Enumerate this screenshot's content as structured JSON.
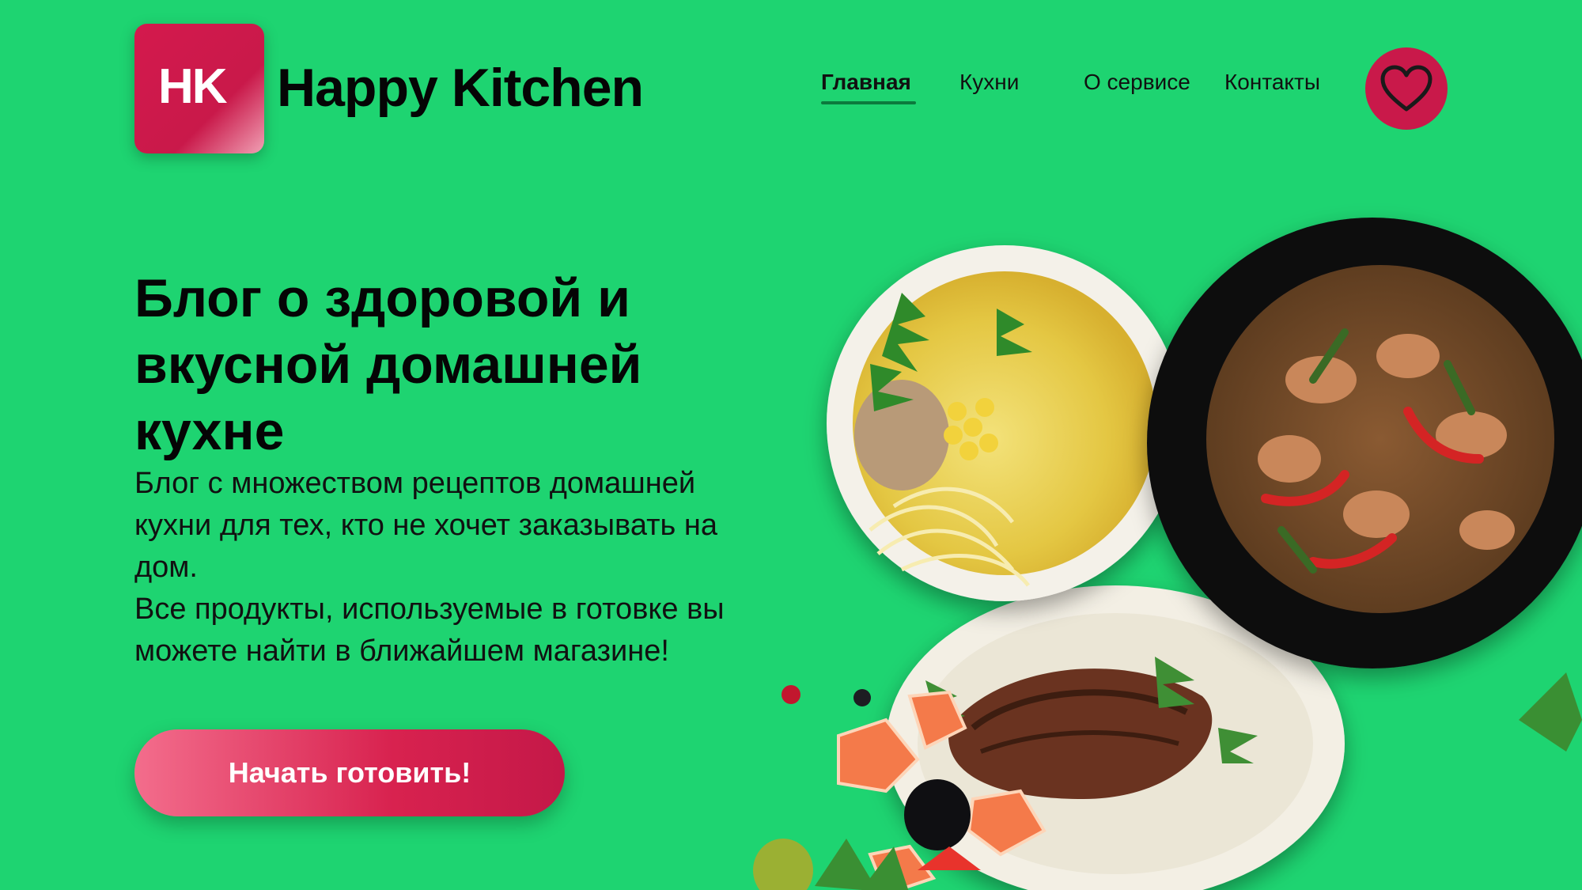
{
  "logo": {
    "initials": "HK",
    "brand_name": "Happy Kitchen"
  },
  "nav": {
    "items": [
      {
        "label": "Главная",
        "active": true
      },
      {
        "label": "Кухни",
        "active": false
      },
      {
        "label": "О сервисе",
        "active": false
      },
      {
        "label": "Контакты",
        "active": false
      }
    ],
    "favorites_icon": "heart-icon"
  },
  "hero": {
    "title": "Блог о здоровой и вкусной домашней кухне",
    "description_1": "Блог с множеством рецептов домашней кухни для тех, кто не хочет заказывать на дом.",
    "description_2": "Все продукты, используемые в готовке вы можете найти в ближайшем магазине!",
    "cta_label": "Начать готовить!"
  },
  "colors": {
    "background": "#1ed471",
    "accent": "#c9194a",
    "text": "#050505"
  }
}
